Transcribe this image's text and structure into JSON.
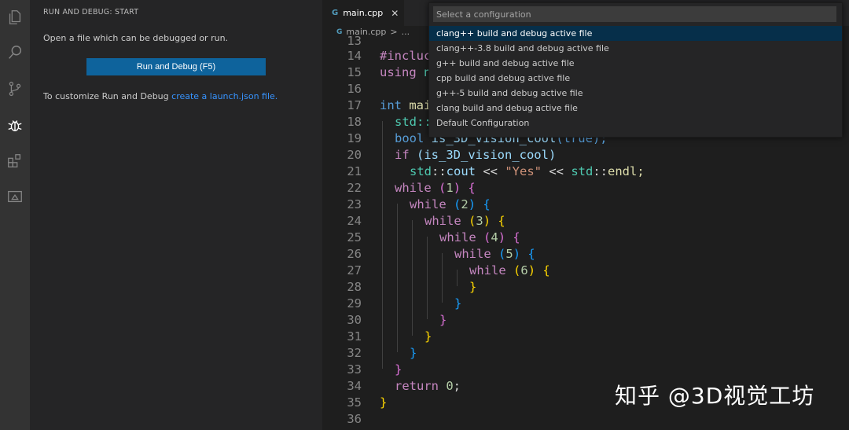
{
  "activity_bar": {
    "icons": [
      "files-icon",
      "search-icon",
      "source-control-icon",
      "debug-icon",
      "extensions-icon",
      "remote-explorer-icon"
    ]
  },
  "sidebar": {
    "title": "RUN AND DEBUG: START",
    "intro": "Open a file which can be debugged or run.",
    "run_button": "Run and Debug (F5)",
    "customize_prefix": "To customize Run and Debug ",
    "customize_link": "create a launch.json file."
  },
  "editor": {
    "tab_label": "main.cpp",
    "breadcrumb_file": "main.cpp",
    "breadcrumb_sep": ">",
    "breadcrumb_more": "..."
  },
  "code_lines": [
    {
      "n": "13"
    },
    {
      "n": "14"
    },
    {
      "n": "15"
    },
    {
      "n": "16"
    },
    {
      "n": "17"
    },
    {
      "n": "18"
    },
    {
      "n": "19"
    },
    {
      "n": "20"
    },
    {
      "n": "21"
    },
    {
      "n": "22"
    },
    {
      "n": "23"
    },
    {
      "n": "24"
    },
    {
      "n": "25"
    },
    {
      "n": "26"
    },
    {
      "n": "27"
    },
    {
      "n": "28"
    },
    {
      "n": "29"
    },
    {
      "n": "30"
    },
    {
      "n": "31"
    },
    {
      "n": "32"
    },
    {
      "n": "33"
    },
    {
      "n": "34"
    },
    {
      "n": "35"
    },
    {
      "n": "36"
    }
  ],
  "code": {
    "l14a": "#incluc",
    "l15a": "using ",
    "l15b": "n",
    "l17a": "int ",
    "l17b": "mai",
    "l18a": "std::",
    "l19a": "bool ",
    "l19b": "is_3D_vision_cool",
    "l19c": "(true);",
    "l20a": "if ",
    "l20b": "(is_3D_vision_cool)",
    "l21a": "std",
    "l21b": "::",
    "l21c": "cout",
    "l21d": " << ",
    "l21e": "\"Yes\"",
    "l21f": " << ",
    "l21g": "std",
    "l21h": "::",
    "l21i": "endl;",
    "while": "while",
    "l22n": "1",
    "l23n": "2",
    "l24n": "3",
    "l25n": "4",
    "l26n": "5",
    "l27n": "6",
    "open": "{",
    "close": "}",
    "ret": "return ",
    "zero": "0",
    "semi": ";"
  },
  "quick_pick": {
    "placeholder": "Select a configuration",
    "items": [
      "clang++ build and debug active file",
      "clang++-3.8 build and debug active file",
      "g++ build and debug active file",
      "cpp build and debug active file",
      "g++-5 build and debug active file",
      "clang build and debug active file",
      "Default Configuration"
    ]
  },
  "watermark": "知乎 @3D视觉工坊",
  "colors": {
    "activity_bar": "#333333",
    "sidebar": "#252526",
    "editor": "#1e1e1e",
    "button": "#0e639c",
    "link": "#3794ff",
    "selected_item": "#062f4a"
  }
}
